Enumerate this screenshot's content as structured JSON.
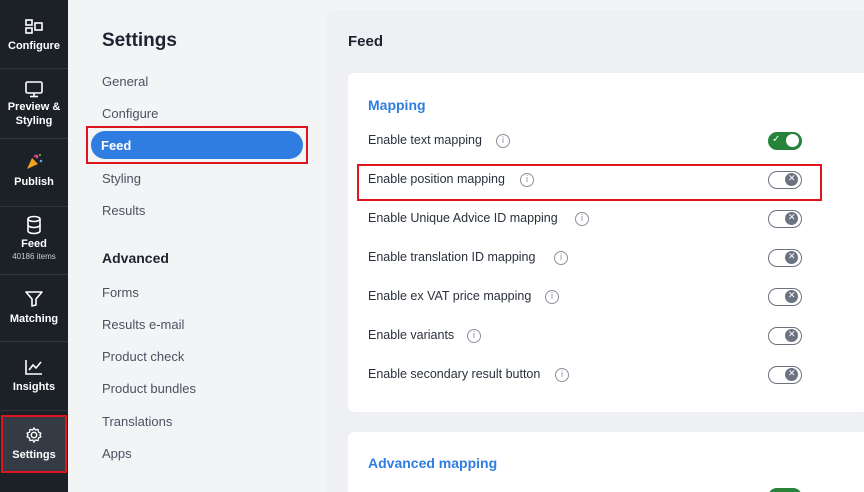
{
  "rail": {
    "configure": "Configure",
    "preview_line1": "Preview &",
    "preview_line2": "Styling",
    "publish": "Publish",
    "feed": "Feed",
    "feed_count": "40186 items",
    "matching": "Matching",
    "insights": "Insights",
    "settings": "Settings"
  },
  "nav": {
    "title": "Settings",
    "items": [
      "General",
      "Configure",
      "Feed",
      "Styling",
      "Results"
    ],
    "advanced_heading": "Advanced",
    "advanced_items": [
      "Forms",
      "Results e-mail",
      "Product check",
      "Product bundles",
      "Translations",
      "Apps"
    ]
  },
  "main": {
    "title": "Feed",
    "mapping": {
      "title": "Mapping",
      "rows": [
        {
          "label": "Enable text mapping",
          "on": true
        },
        {
          "label": "Enable position mapping",
          "on": false
        },
        {
          "label": "Enable Unique Advice ID mapping",
          "on": false
        },
        {
          "label": "Enable translation ID mapping",
          "on": false
        },
        {
          "label": "Enable ex VAT price mapping",
          "on": false
        },
        {
          "label": "Enable variants",
          "on": false
        },
        {
          "label": "Enable secondary result button",
          "on": false
        }
      ]
    },
    "advanced_mapping_title": "Advanced mapping"
  },
  "colors": {
    "accent": "#2f7de1",
    "toggle_on": "#27823a",
    "highlight": "#e0141e",
    "rail_bg": "#1c2128"
  },
  "icons": {
    "info": "i",
    "check": "✓",
    "cross": "✕"
  }
}
